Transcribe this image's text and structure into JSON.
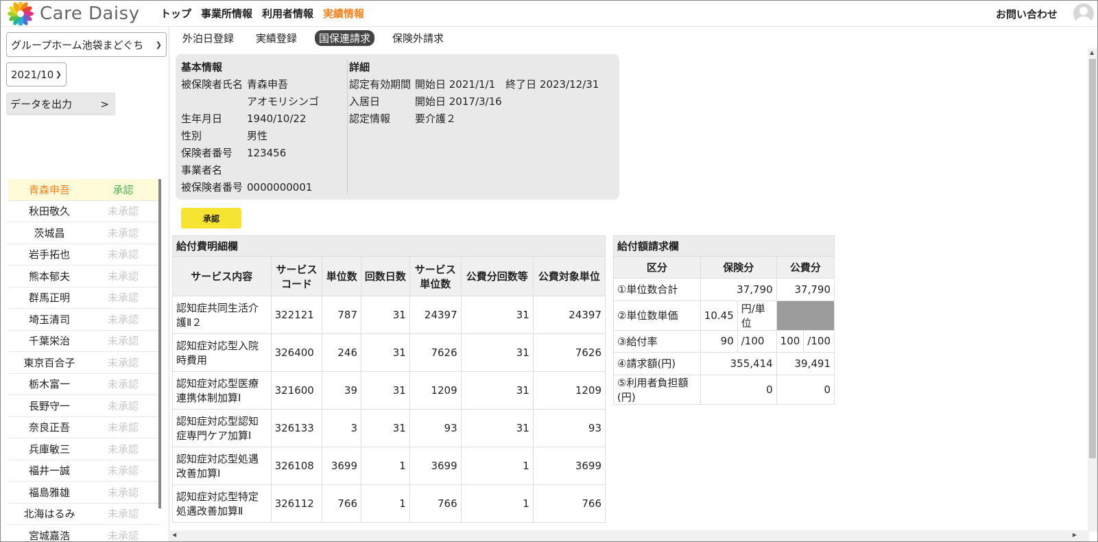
{
  "header": {
    "brand": "Care Daisy",
    "nav": [
      "トップ",
      "事業所情報",
      "利用者情報",
      "実績情報"
    ],
    "active_nav": "実績情報",
    "contact": "お問い合わせ",
    "accent_color": "#f5821f"
  },
  "sidebar": {
    "facility": "グループホーム池袋まどぐち",
    "month": "2021/10",
    "export_label": "データを出力",
    "export_arrow": ">",
    "users": [
      {
        "name": "青森申吾",
        "status": "承認",
        "selected": true
      },
      {
        "name": "秋田敬久",
        "status": "未承認"
      },
      {
        "name": "茨城昌",
        "status": "未承認"
      },
      {
        "name": "岩手拓也",
        "status": "未承認"
      },
      {
        "name": "熊本郁夫",
        "status": "未承認"
      },
      {
        "name": "群馬正明",
        "status": "未承認"
      },
      {
        "name": "埼玉清司",
        "status": "未承認"
      },
      {
        "name": "千葉栄治",
        "status": "未承認"
      },
      {
        "name": "東京百合子",
        "status": "未承認"
      },
      {
        "name": "栃木富一",
        "status": "未承認"
      },
      {
        "name": "長野守一",
        "status": "未承認"
      },
      {
        "name": "奈良正吾",
        "status": "未承認"
      },
      {
        "name": "兵庫敏三",
        "status": "未承認"
      },
      {
        "name": "福井一誠",
        "status": "未承認"
      },
      {
        "name": "福島雅雄",
        "status": "未承認"
      },
      {
        "name": "北海はるみ",
        "status": "未承認"
      },
      {
        "name": "宮城嘉浩",
        "status": "未承認"
      }
    ]
  },
  "subtabs": [
    "外泊日登録",
    "実績登録",
    "国保連請求",
    "保険外請求"
  ],
  "active_subtab": "国保連請求",
  "basic": {
    "title": "基本情報",
    "rows": [
      {
        "k": "被保険者氏名",
        "v": "青森申吾"
      },
      {
        "k": "",
        "v": "アオモリシンゴ"
      },
      {
        "k": "生年月日",
        "v": "1940/10/22"
      },
      {
        "k": "性別",
        "v": "男性"
      },
      {
        "k": "保険者番号",
        "v": "123456"
      },
      {
        "k": "事業者名",
        "v": ""
      },
      {
        "k": "被保険者番号",
        "v": "0000000001"
      }
    ]
  },
  "detail": {
    "title": "詳細",
    "rows": [
      {
        "k": "認定有効期間",
        "v": "開始日 2021/1/1　終了日 2023/12/31"
      },
      {
        "k": "入居日",
        "v": "開始日 2017/3/16"
      },
      {
        "k": "認定情報",
        "v": "要介護２"
      }
    ]
  },
  "approve_label": "承認",
  "benefit_detail": {
    "title": "給付費明細欄",
    "headers": [
      "サービス内容",
      "サービスコード",
      "単位数",
      "回数日数",
      "サービス単位数",
      "公費分回数等",
      "公費対象単位"
    ],
    "rows": [
      [
        "認知症共同生活介護Ⅱ２",
        "322121",
        "787",
        "31",
        "24397",
        "31",
        "24397"
      ],
      [
        "認知症対応型入院時費用",
        "326400",
        "246",
        "31",
        "7626",
        "31",
        "7626"
      ],
      [
        "認知症対応型医療連携体制加算Ⅰ",
        "321600",
        "39",
        "31",
        "1209",
        "31",
        "1209"
      ],
      [
        "認知症対応型認知症専門ケア加算Ⅰ",
        "326133",
        "3",
        "31",
        "93",
        "31",
        "93"
      ],
      [
        "認知症対応型処遇改善加算Ⅰ",
        "326108",
        "3699",
        "1",
        "3699",
        "1",
        "3699"
      ],
      [
        "認知症対応型特定処遇改善加算Ⅱ",
        "326112",
        "766",
        "1",
        "766",
        "1",
        "766"
      ]
    ]
  },
  "claim": {
    "title": "給付額請求欄",
    "headers": [
      "区分",
      "保険分",
      "公費分"
    ],
    "r1": {
      "label": "①単位数合計",
      "ins": "37,790",
      "pub": "37,790"
    },
    "r2": {
      "label": "②単位数単価",
      "ins": "10.45",
      "unit": "円/単位"
    },
    "r3": {
      "label": "③給付率",
      "ins": "90",
      "ins_unit": "/100",
      "pub": "100",
      "pub_unit": "/100"
    },
    "r4": {
      "label": "④請求額(円)",
      "ins": "355,414",
      "pub": "39,491"
    },
    "r5": {
      "label": "⑤利用者負担額(円)",
      "ins": "0",
      "pub": "0"
    }
  }
}
